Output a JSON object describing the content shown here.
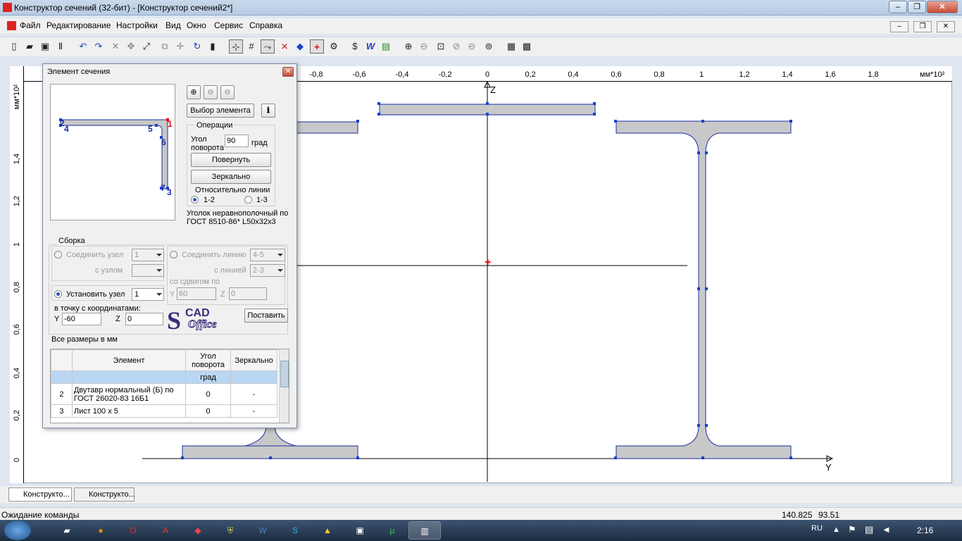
{
  "window": {
    "title": "Конструктор сечений (32-бит) - [Конструктор сечений2*]"
  },
  "menu": [
    "Файл",
    "Редактирование",
    "Настройки",
    "Вид",
    "Окно",
    "Сервис",
    "Справка"
  ],
  "ruler": {
    "unit": "мм*10²",
    "top_ticks": [
      "-0,8",
      "-0,6",
      "-0,4",
      "-0,2",
      "0",
      "0,2",
      "0,4",
      "0,6",
      "0,8",
      "1",
      "1,2",
      "1,4",
      "1,6",
      "1,8"
    ],
    "left_ticks": [
      "1,4",
      "1,2",
      "1",
      "0,8",
      "0,6",
      "0,4",
      "0,2",
      "0"
    ]
  },
  "drawing": {
    "axis_z": "Z",
    "axis_y": "Y"
  },
  "dialog": {
    "title": "Элемент сечения",
    "select_button": "Выбор элемента",
    "operations_title": "Операции",
    "angle_label": "Угол поворота",
    "angle_value": "90",
    "angle_unit": "град",
    "rotate_button": "Повернуть",
    "mirror_button": "Зеркально",
    "relative_line": "Относительно линии",
    "opt_12": "1-2",
    "opt_13": "1-3",
    "element_desc": "Уголок неравнополочный по ГОСТ 8510-86* L50x32x3",
    "preview_nodes": [
      "1",
      "2",
      "4",
      "5",
      "6",
      "7",
      "3"
    ],
    "assembly_title": "Сборка",
    "connect_node": "Соединить узел",
    "connect_node_val": "1",
    "with_node": "с узлом",
    "connect_line": "Соединить линию",
    "connect_line_val": "4-5",
    "with_line": "с линией",
    "with_line_val": "2-3",
    "with_shift": "со сдвигом по",
    "shift_y": "60",
    "shift_z": "0",
    "set_node": "Установить узел",
    "set_node_val": "1",
    "to_point": "в точку с координатами:",
    "coord_y_label": "Y",
    "coord_y": "-60",
    "coord_z_label": "Z",
    "coord_z": "0",
    "place_button": "Поставить",
    "logo_line1": "CAD",
    "logo_line2": "Office",
    "all_sizes": "Все размеры в мм",
    "table": {
      "headers": [
        "Элемент",
        "Угол поворота",
        "Зеркально"
      ],
      "unit_row": "град",
      "rows": [
        {
          "n": "2",
          "element": "Двутавр нормальный (Б) по ГОСТ 26020-83  16Б1",
          "angle": "0",
          "mirror": "-"
        },
        {
          "n": "3",
          "element": "Лист 100 x 5",
          "angle": "0",
          "mirror": "-"
        }
      ]
    }
  },
  "tabs": [
    "Конструкто...",
    "Конструкто..."
  ],
  "status": {
    "text": "Ожидание команды",
    "coord1": "140.825",
    "coord2": "93.51"
  },
  "taskbar": {
    "lang": "RU",
    "time": "2:16"
  }
}
